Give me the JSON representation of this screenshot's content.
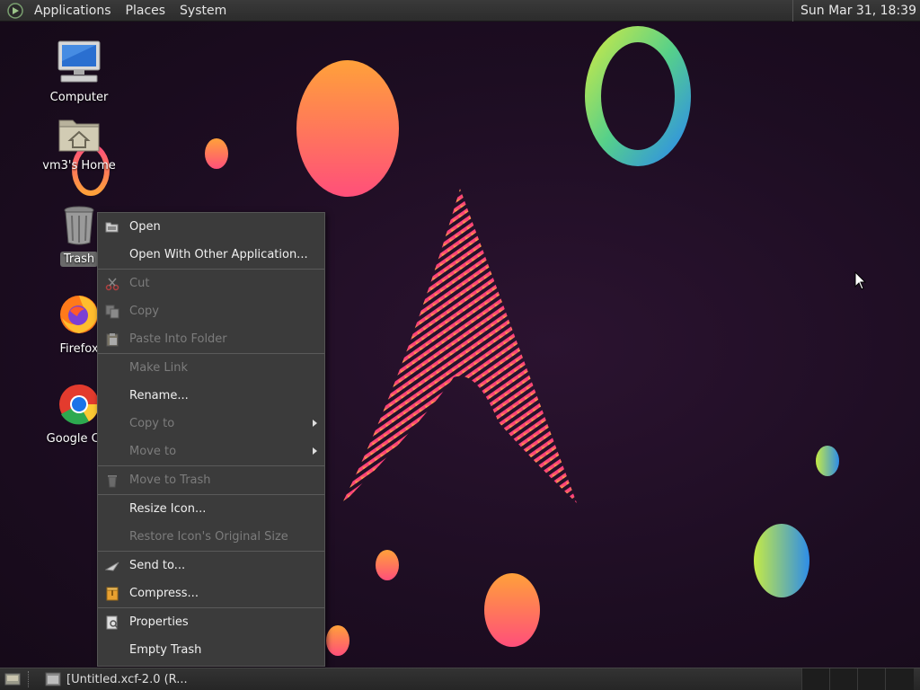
{
  "top_panel": {
    "menus": [
      "Applications",
      "Places",
      "System"
    ],
    "clock": "Sun Mar 31, 18:39"
  },
  "desktop_icons": [
    {
      "label": "Computer",
      "icon": "computer-icon"
    },
    {
      "label": "vm3's Home",
      "icon": "home-folder-icon"
    },
    {
      "label": "Trash",
      "icon": "trash-icon",
      "selected": true
    },
    {
      "label": "Firefox",
      "icon": "firefox-icon"
    },
    {
      "label": "Google Chr",
      "icon": "chrome-icon"
    }
  ],
  "context_menu": {
    "items": [
      {
        "label": "Open",
        "enabled": true,
        "icon": "open-folder-icon"
      },
      {
        "label": "Open With Other Application...",
        "enabled": true
      },
      {
        "label": "Cut",
        "enabled": false,
        "icon": "scissors-icon"
      },
      {
        "label": "Copy",
        "enabled": false,
        "icon": "copy-icon"
      },
      {
        "label": "Paste Into Folder",
        "enabled": false,
        "icon": "paste-icon"
      },
      {
        "label": "Make Link",
        "enabled": false
      },
      {
        "label": "Rename...",
        "enabled": true
      },
      {
        "label": "Copy to",
        "enabled": false,
        "submenu": true
      },
      {
        "label": "Move to",
        "enabled": false,
        "submenu": true
      },
      {
        "label": "Move to Trash",
        "enabled": false,
        "icon": "trash-small-icon"
      },
      {
        "label": "Resize Icon...",
        "enabled": true
      },
      {
        "label": "Restore Icon's Original Size",
        "enabled": false
      },
      {
        "label": "Send to...",
        "enabled": true,
        "icon": "send-icon"
      },
      {
        "label": "Compress...",
        "enabled": true,
        "icon": "archive-icon"
      },
      {
        "label": "Properties",
        "enabled": true,
        "icon": "properties-icon"
      },
      {
        "label": "Empty Trash",
        "enabled": true
      }
    ]
  },
  "bottom_panel": {
    "task_label": "[Untitled.xcf-2.0 (R..."
  },
  "colors": {
    "background": "#1d0d22",
    "menu_bg": "#3b3b3b",
    "panel_bg": "#2c2c2c",
    "orange": "#ff8a3d",
    "pink": "#ff3f7a",
    "green": "#a8e04a",
    "blue": "#3a8be0"
  }
}
